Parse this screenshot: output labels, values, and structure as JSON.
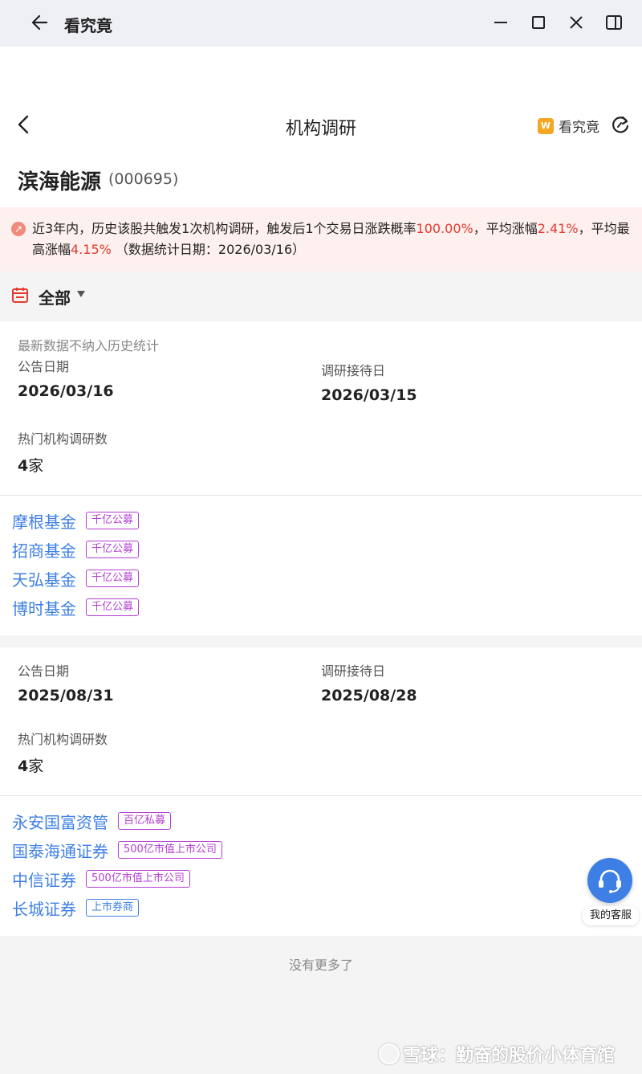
{
  "window": {
    "title": "看究竟"
  },
  "nav": {
    "title": "机构调研",
    "brand_logo": "W",
    "brand_label": "看究竟"
  },
  "stock": {
    "name": "滨海能源",
    "code": "(000695)"
  },
  "summary": {
    "part1": "近3年内，历史该股共触发1次机构调研，触发后1个交易日涨跌概率",
    "prob": "100.00%",
    "part2": "，平均涨幅",
    "avg_rise": "2.41%",
    "part3": "，平均最高涨幅",
    "avg_max_rise": "4.15%",
    "part4": " （数据统计日期：2026/03/16）"
  },
  "filter": {
    "label": "全部"
  },
  "labels": {
    "announce_date": "公告日期",
    "visit_date": "调研接待日",
    "hot_count": "热门机构调研数"
  },
  "records": [
    {
      "note": "最新数据不纳入历史统计",
      "announce_date": "2026/03/16",
      "visit_date": "2026/03/15",
      "count_num": "4",
      "count_unit": "家",
      "institutions": [
        {
          "name": "摩根基金",
          "tag": "千亿公募",
          "tag_color": "purple"
        },
        {
          "name": "招商基金",
          "tag": "千亿公募",
          "tag_color": "purple"
        },
        {
          "name": "天弘基金",
          "tag": "千亿公募",
          "tag_color": "purple"
        },
        {
          "name": "博时基金",
          "tag": "千亿公募",
          "tag_color": "purple"
        }
      ]
    },
    {
      "announce_date": "2025/08/31",
      "visit_date": "2025/08/28",
      "count_num": "4",
      "count_unit": "家",
      "institutions": [
        {
          "name": "永安国富资管",
          "tag": "百亿私募",
          "tag_color": "purple"
        },
        {
          "name": "国泰海通证券",
          "tag": "500亿市值上市公司",
          "tag_color": "purple"
        },
        {
          "name": "中信证券",
          "tag": "500亿市值上市公司",
          "tag_color": "purple"
        },
        {
          "name": "长城证券",
          "tag": "上市券商",
          "tag_color": "blue"
        }
      ]
    }
  ],
  "footer": {
    "no_more": "没有更多了"
  },
  "service": {
    "label": "我的客服"
  },
  "watermark": {
    "text": "雪球：勤奋的股价小体育馆"
  },
  "colors": {
    "accent_blue": "#3d7fe4",
    "red": "#e63a2e",
    "tag_purple": "#b43fd3"
  }
}
